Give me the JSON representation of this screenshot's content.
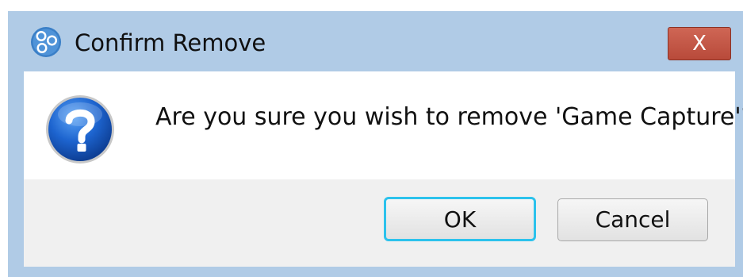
{
  "dialog": {
    "title": "Confirm Remove",
    "close_label": "X",
    "message": "Are you sure you wish to remove 'Game Capture'?",
    "app_icon": "obs-logo-icon",
    "message_icon": "question-icon"
  },
  "buttons": {
    "ok_label": "OK",
    "cancel_label": "Cancel"
  },
  "colors": {
    "titlebar": "#b0cbe6",
    "close_button": "#c65a4a",
    "ok_focus_border": "#2cc2ec",
    "question_icon": "#1a5fc4"
  }
}
